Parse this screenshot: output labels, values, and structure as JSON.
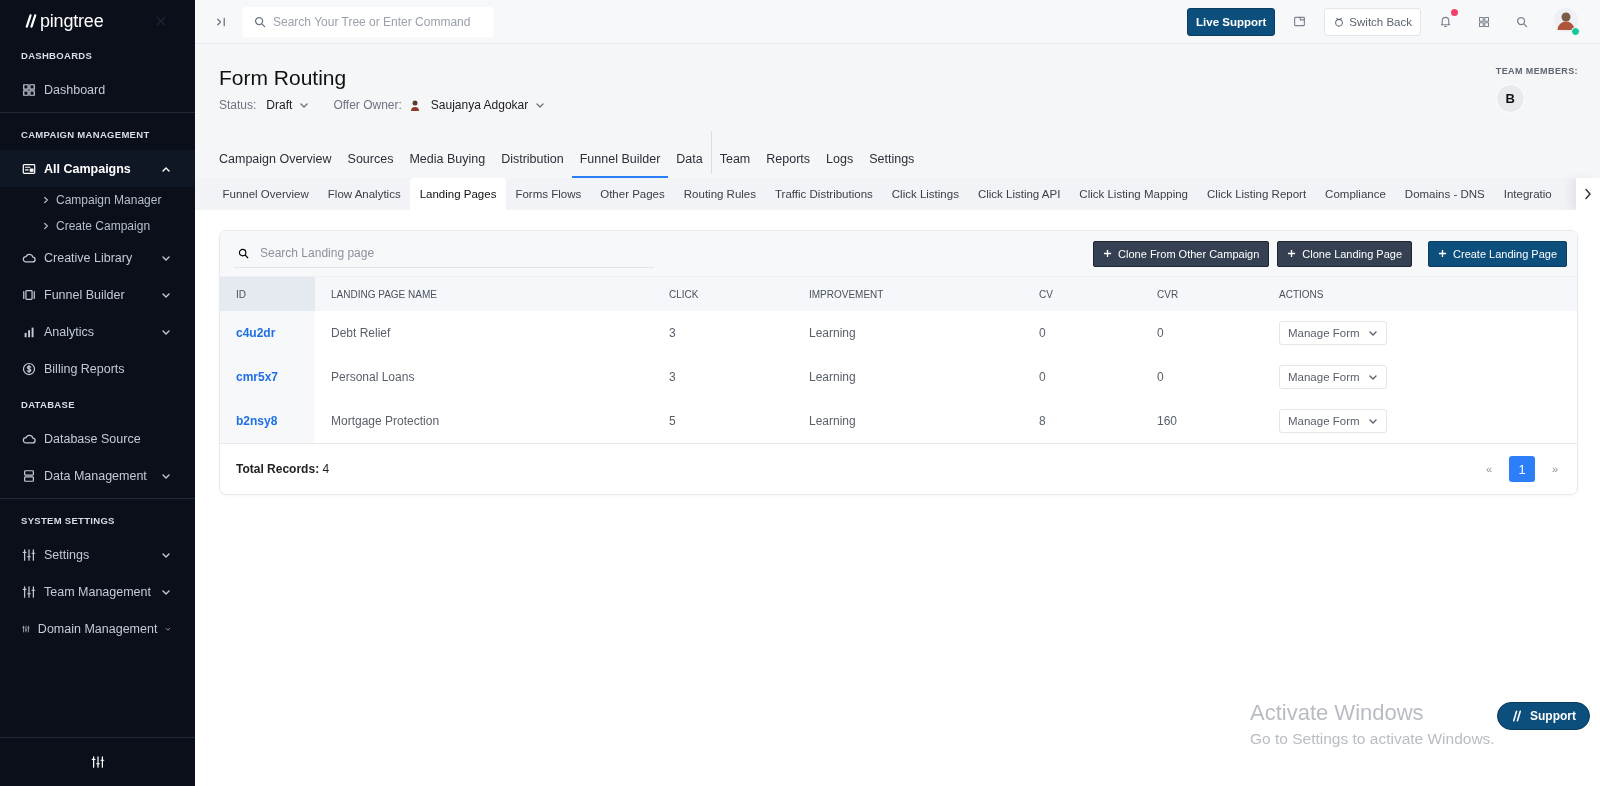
{
  "sidebar": {
    "logo": "pingtree",
    "sections": [
      {
        "title": "DASHBOARDS",
        "items": [
          {
            "label": "Dashboard",
            "selected": false
          }
        ]
      },
      {
        "title": "CAMPAIGN MANAGEMENT",
        "items": [
          {
            "label": "All Campaigns",
            "selected": true,
            "expanded": true,
            "children": [
              {
                "label": "Campaign Manager"
              },
              {
                "label": "Create Campaign"
              }
            ]
          },
          {
            "label": "Creative Library",
            "selected": false,
            "expanded": false
          },
          {
            "label": "Funnel Builder",
            "selected": false,
            "expanded": false
          },
          {
            "label": "Analytics",
            "selected": false,
            "expanded": false
          },
          {
            "label": "Billing Reports",
            "selected": false
          }
        ]
      },
      {
        "title": "DATABASE",
        "items": [
          {
            "label": "Database Source",
            "selected": false
          },
          {
            "label": "Data Management",
            "selected": false,
            "expanded": false
          }
        ]
      },
      {
        "title": "SYSTEM SETTINGS",
        "items": [
          {
            "label": "Settings",
            "selected": false,
            "expanded": false
          },
          {
            "label": "Team Management",
            "selected": false,
            "expanded": false
          },
          {
            "label": "Domain Management",
            "selected": false,
            "expanded": false
          }
        ]
      }
    ]
  },
  "topbar": {
    "search": {
      "placeholder": "Search Your Tree or Enter Command"
    },
    "live_support": "Live Support",
    "switch_back": "Switch Back",
    "notifications_unread": true,
    "user_online": true
  },
  "header": {
    "title": "Form Routing",
    "status_label": "Status:",
    "status": "Draft",
    "owner_label": "Offer Owner:",
    "owner": "Saujanya Adgokar",
    "team_label": "TEAM MEMBERS:",
    "team_members": [
      "B"
    ]
  },
  "main_tabs": [
    {
      "label": "Campaign Overview",
      "selected": false
    },
    {
      "label": "Sources",
      "selected": false
    },
    {
      "label": "Media Buying",
      "selected": false
    },
    {
      "label": "Distribution",
      "selected": false
    },
    {
      "label": "Funnel Builder",
      "selected": true
    },
    {
      "label": "Data",
      "selected": false
    },
    {
      "label": "Team",
      "selected": false,
      "divider_before": true
    },
    {
      "label": "Reports",
      "selected": false
    },
    {
      "label": "Logs",
      "selected": false
    },
    {
      "label": "Settings",
      "selected": false
    }
  ],
  "sub_tabs": [
    {
      "label": "Funnel Overview",
      "selected": false
    },
    {
      "label": "Flow Analytics",
      "selected": false
    },
    {
      "label": "Landing Pages",
      "selected": true
    },
    {
      "label": "Forms Flows",
      "selected": false
    },
    {
      "label": "Other Pages",
      "selected": false
    },
    {
      "label": "Routing Rules",
      "selected": false
    },
    {
      "label": "Traffic Distributions",
      "selected": false
    },
    {
      "label": "Click Listings",
      "selected": false
    },
    {
      "label": "Click Listing API",
      "selected": false
    },
    {
      "label": "Click Listing Mapping",
      "selected": false
    },
    {
      "label": "Click Listing Report",
      "selected": false
    },
    {
      "label": "Compliance",
      "selected": false
    },
    {
      "label": "Domains - DNS",
      "selected": false
    },
    {
      "label": "Integratio",
      "selected": false
    }
  ],
  "table_card": {
    "search": {
      "placeholder": "Search Landing page"
    },
    "buttons": [
      {
        "label": "Clone From Other Campaign",
        "kind": "dark"
      },
      {
        "label": "Clone Landing Page",
        "kind": "dark"
      },
      {
        "label": "Create Landing Page",
        "kind": "primary"
      }
    ],
    "columns": [
      "ID",
      "LANDING PAGE NAME",
      "CLICK",
      "IMPROVEMENT",
      "CV",
      "CVR",
      "ACTIONS"
    ],
    "rows": [
      {
        "id": "c4u2dr",
        "name": "Debt Relief",
        "click": "3",
        "improvement": "Learning",
        "cv": "0",
        "cvr": "0",
        "action": "Manage Form"
      },
      {
        "id": "cmr5x7",
        "name": "Personal Loans",
        "click": "3",
        "improvement": "Learning",
        "cv": "0",
        "cvr": "0",
        "action": "Manage Form"
      },
      {
        "id": "b2nsy8",
        "name": "Mortgage Protection",
        "click": "5",
        "improvement": "Learning",
        "cv": "8",
        "cvr": "160",
        "action": "Manage Form"
      }
    ],
    "total": "**Total Records:** 4",
    "pagination": [
      {
        "label": "«",
        "kind": "prev",
        "selected": false
      },
      {
        "label": "1",
        "kind": "page",
        "selected": true
      },
      {
        "label": "»",
        "kind": "next",
        "selected": false
      }
    ]
  },
  "support_button": "Support",
  "os_notice": {
    "title": "Activate Windows",
    "text": "Go to Settings to activate Windows."
  }
}
